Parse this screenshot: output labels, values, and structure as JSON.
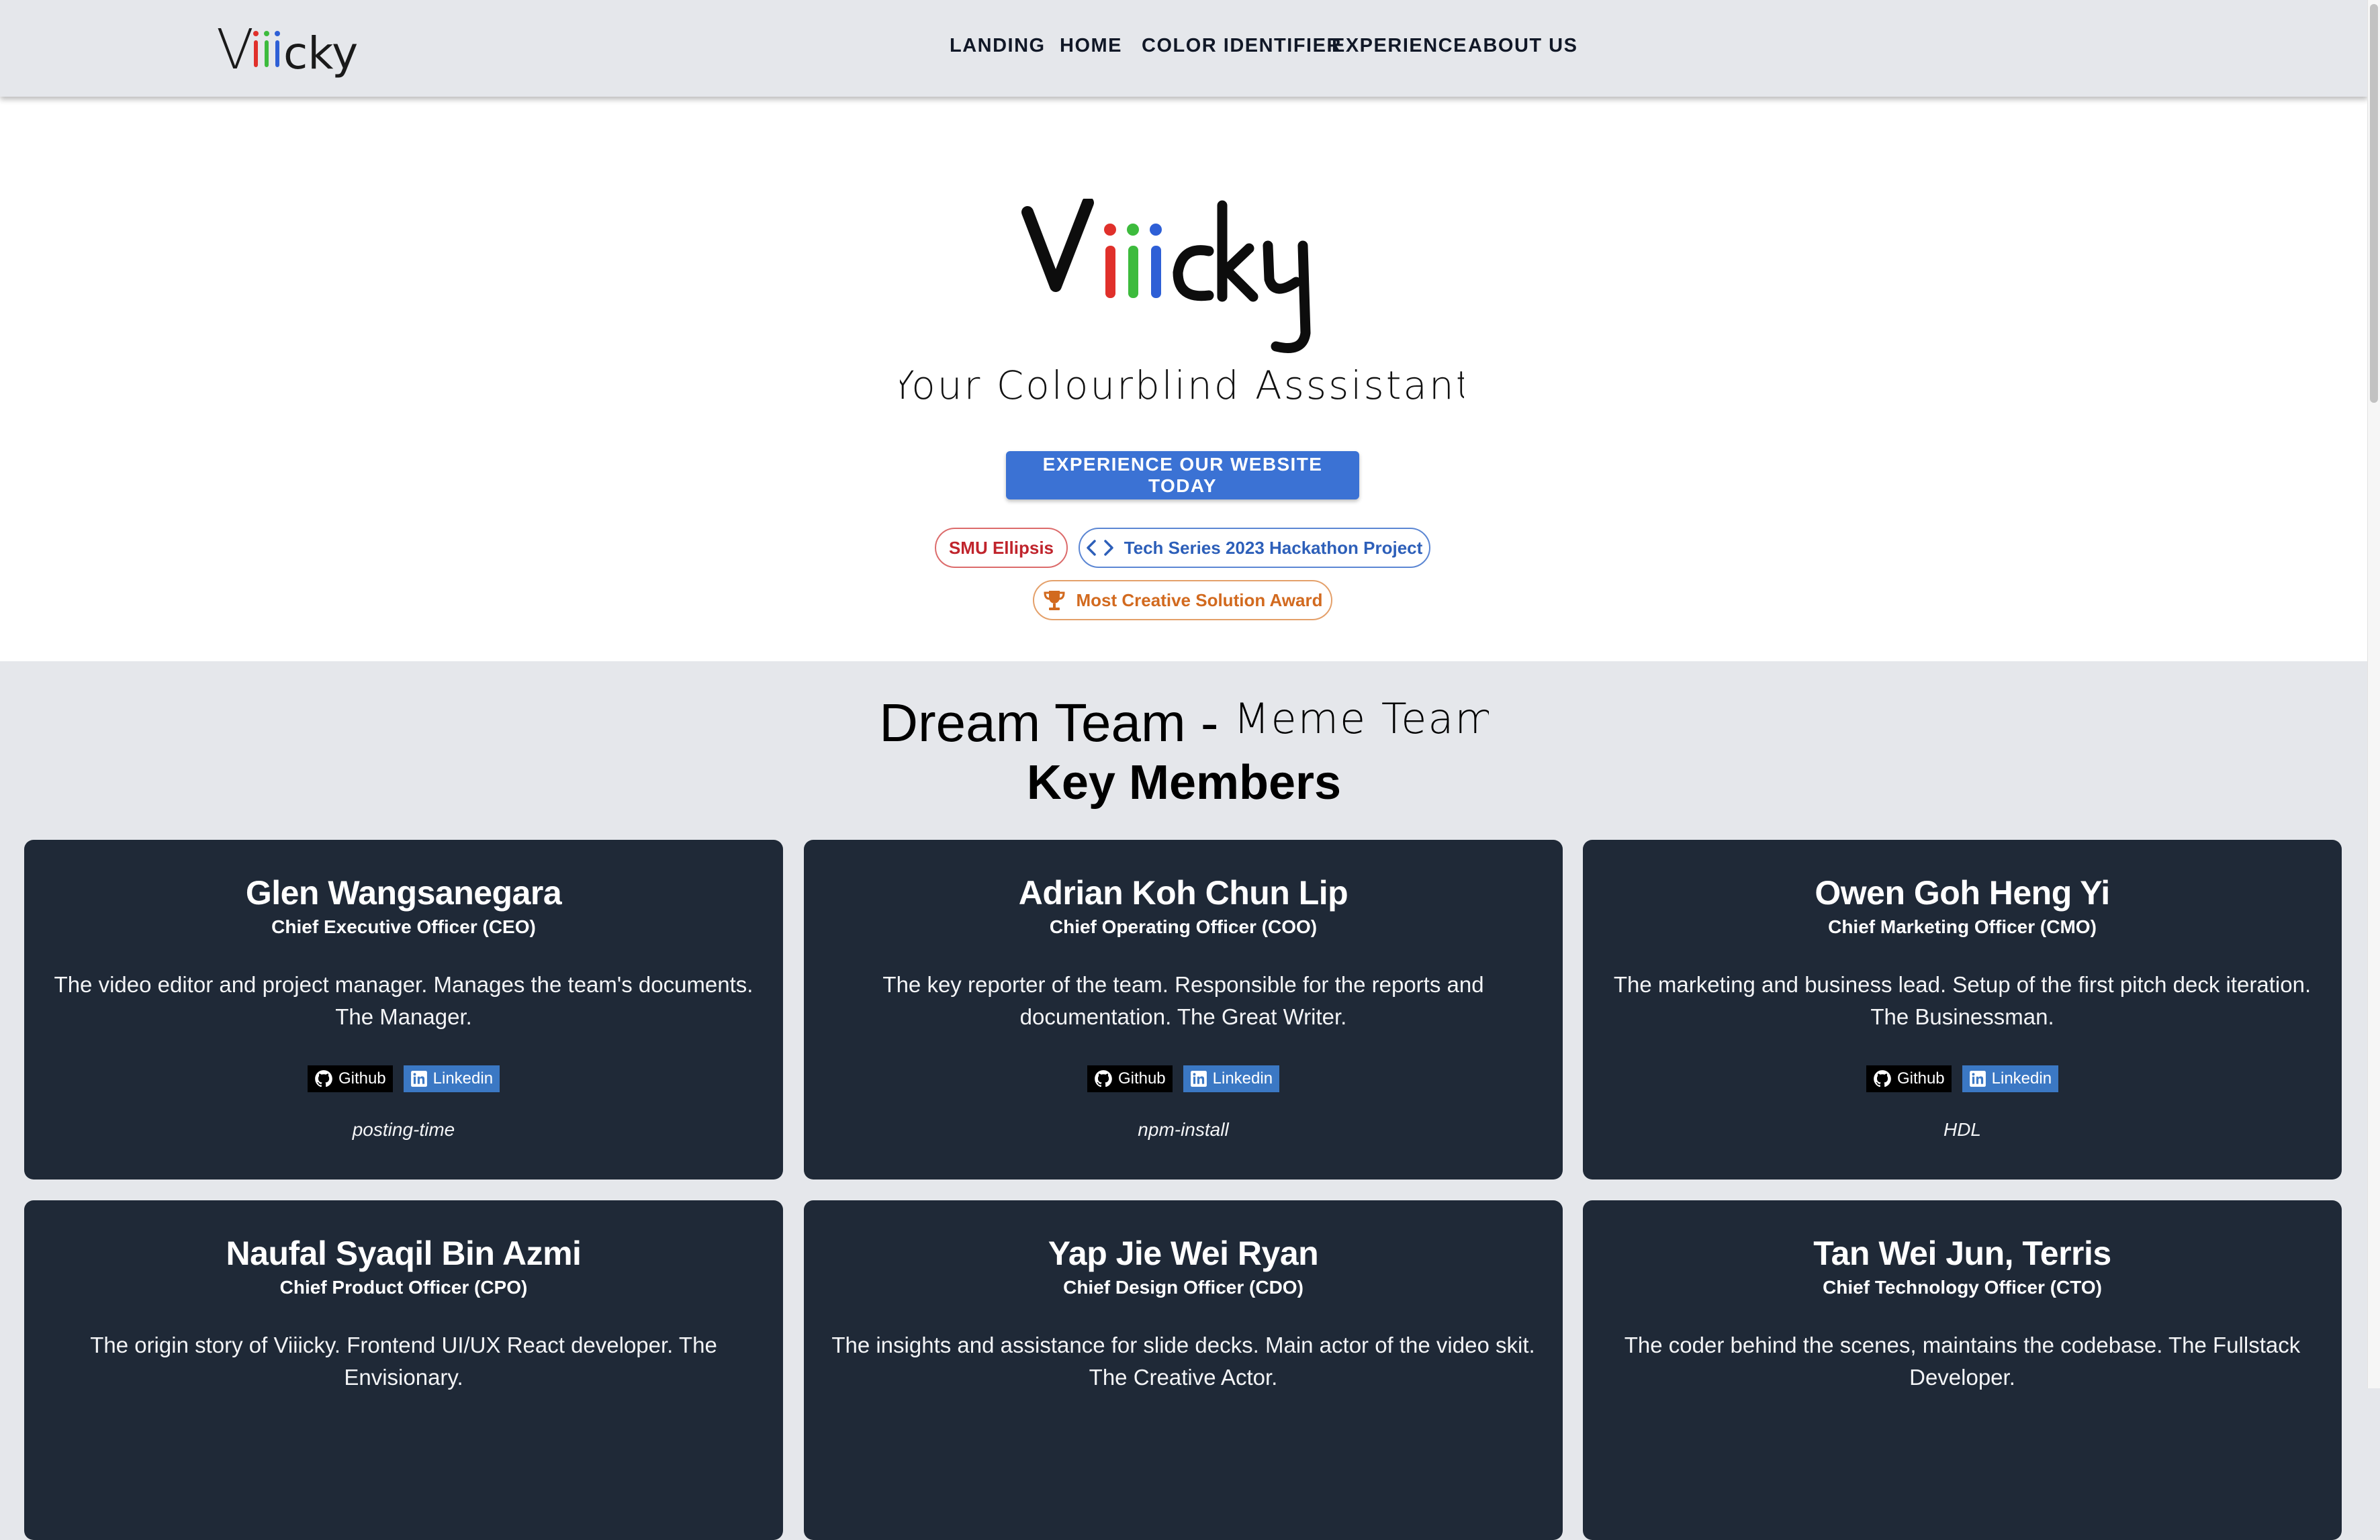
{
  "nav": {
    "logo_text": "Viiicky",
    "links": [
      "LANDING",
      "HOME",
      "COLOR IDENTIFIER",
      "EXPERIENCE",
      "ABOUT US"
    ]
  },
  "hero": {
    "logo_text": "Viiicky",
    "tagline": "Your Colourblind Asssistant",
    "cta_label": "EXPERIENCE OUR WEBSITE TODAY",
    "badges": {
      "smu": "SMU Ellipsis",
      "tech": "Tech Series 2023 Hackathon Project",
      "award": "Most Creative Solution Award"
    }
  },
  "team": {
    "title_main": "Dream Team - ",
    "title_script": "Meme Team",
    "subtitle": "Key Members",
    "link_github": "Github",
    "link_linkedin": "Linkedin",
    "members": [
      {
        "name": "Glen Wangsanegara",
        "role": "Chief Executive Officer (CEO)",
        "desc": "The video editor and project manager. Manages the team's documents. The Manager.",
        "handle": "posting-time"
      },
      {
        "name": "Adrian Koh Chun Lip",
        "role": "Chief Operating Officer (COO)",
        "desc": "The key reporter of the team. Responsible for the reports and documentation. The Great Writer.",
        "handle": "npm-install"
      },
      {
        "name": "Owen Goh Heng Yi",
        "role": "Chief Marketing Officer (CMO)",
        "desc": "The marketing and business lead. Setup of the first pitch deck iteration. The Businessman.",
        "handle": "HDL"
      },
      {
        "name": "Naufal Syaqil Bin Azmi",
        "role": "Chief Product Officer (CPO)",
        "desc": "The origin story of Viiicky. Frontend UI/UX React developer. The Envisionary.",
        "handle": ""
      },
      {
        "name": "Yap Jie Wei Ryan",
        "role": "Chief Design Officer (CDO)",
        "desc": "The insights and assistance for slide decks. Main actor of the video skit. The Creative Actor.",
        "handle": ""
      },
      {
        "name": "Tan Wei Jun, Terris",
        "role": "Chief Technology Officer (CTO)",
        "desc": "The coder behind the scenes, maintains the codebase. The Fullstack Developer.",
        "handle": ""
      }
    ]
  },
  "colors": {
    "i_red": "#e0302b",
    "i_green": "#3dbb3d",
    "i_blue": "#2e5fd6",
    "card_bg": "#1f2937",
    "cta_bg": "#3b72d4"
  }
}
